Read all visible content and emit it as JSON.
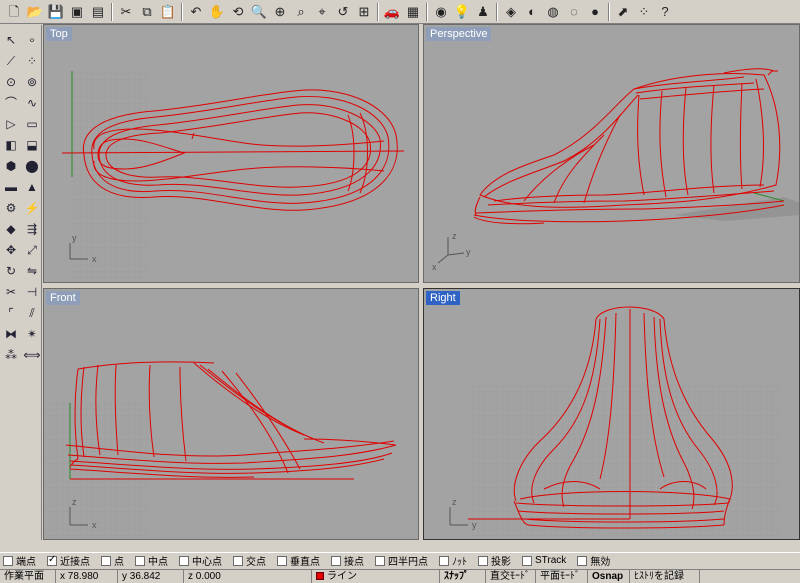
{
  "top_toolbar": {
    "icons": [
      "new-document-icon",
      "open-folder-icon",
      "save-icon",
      "print-icon",
      "properties-icon",
      "cut-icon",
      "copy-icon",
      "paste-icon",
      "undo-icon",
      "pan-hand-icon",
      "rotate-view-icon",
      "zoom-icon",
      "zoom-window-icon",
      "zoom-extents-icon",
      "zoom-selected-icon",
      "undo-view-icon",
      "four-viewports-icon",
      "car-icon",
      "grid-icon",
      "eye-icon",
      "light-bulb-icon",
      "lamp-icon",
      "color-icon",
      "render-sphere-icon",
      "wire-sphere-icon",
      "ghosted-sphere-icon",
      "shaded-sphere-icon",
      "cursor-arrow-icon",
      "snap-points-icon",
      "help-icon"
    ],
    "glyphs": [
      "🗋",
      "📂",
      "💾",
      "▣",
      "▤",
      "✂",
      "⧉",
      "📋",
      "↶",
      "✋",
      "⟲",
      "🔍",
      "⊕",
      "⌕",
      "⌖",
      "↺",
      "⊞",
      "🚗",
      "▦",
      "◉",
      "💡",
      "♟",
      "◈",
      "◐",
      "◍",
      "◌",
      "●",
      "⬈",
      "⁘",
      "?"
    ]
  },
  "left_toolbar": {
    "icons": [
      "select-arrow-icon",
      "point-icon",
      "polyline-icon",
      "control-points-icon",
      "circle-icon",
      "circle-points-icon",
      "arc-icon",
      "curve-icon",
      "polygon-icon",
      "rectangle-icon",
      "surface-icon",
      "extrude-icon",
      "box-icon",
      "sphere-icon",
      "cylinder-icon",
      "cone-icon",
      "gear-icon",
      "edit-icon",
      "solid-icon",
      "flow-icon",
      "move-icon",
      "scale-icon",
      "rotate-icon",
      "mirror-icon",
      "trim-icon",
      "split-icon",
      "fillet-icon",
      "offset-icon",
      "join-icon",
      "explode-icon",
      "array-icon",
      "dimension-icon"
    ],
    "glyphs": [
      "↖",
      "∘",
      "⟋",
      "⁘",
      "⊙",
      "⊚",
      "⌒",
      "∿",
      "▷",
      "▭",
      "◧",
      "⬓",
      "⬢",
      "⬤",
      "▬",
      "▲",
      "⚙",
      "⚡",
      "◆",
      "⇶",
      "✥",
      "⤢",
      "↻",
      "⇋",
      "✂",
      "⊣",
      "⌜",
      "⫽",
      "⧓",
      "✴",
      "⁂",
      "⟺"
    ]
  },
  "viewports": {
    "top": {
      "title": "Top"
    },
    "perspective": {
      "title": "Perspective"
    },
    "front": {
      "title": "Front"
    },
    "right": {
      "title": "Right"
    }
  },
  "osnap": {
    "items": [
      {
        "label": "端点",
        "checked": false
      },
      {
        "label": "近接点",
        "checked": true
      },
      {
        "label": "点",
        "checked": false
      },
      {
        "label": "中点",
        "checked": false
      },
      {
        "label": "中心点",
        "checked": false
      },
      {
        "label": "交点",
        "checked": false
      },
      {
        "label": "垂直点",
        "checked": false
      },
      {
        "label": "接点",
        "checked": false
      },
      {
        "label": "四半円点",
        "checked": false
      },
      {
        "label": "ﾉｯﾄ",
        "checked": false
      },
      {
        "label": "投影",
        "checked": false
      },
      {
        "label": "STrack",
        "checked": false
      },
      {
        "label": "無効",
        "checked": false
      }
    ]
  },
  "status": {
    "cplane": "作業平面",
    "x": "x 78.980",
    "y": "y 36.842",
    "z": "z 0.000",
    "layer": "ライン",
    "layer_color": "#e00000",
    "snap": "ｽﾅｯﾌﾟ",
    "ortho": "直交ﾓｰﾄﾞ",
    "planar": "平面ﾓｰﾄﾞ",
    "osnap": "Osnap",
    "history": "ﾋｽﾄﾘを記録"
  },
  "colors": {
    "viewport_bg": "#a3a3a3",
    "curve": "#e00000",
    "active_title": "#2e63c5",
    "inactive_title": "#8f9eb8"
  }
}
